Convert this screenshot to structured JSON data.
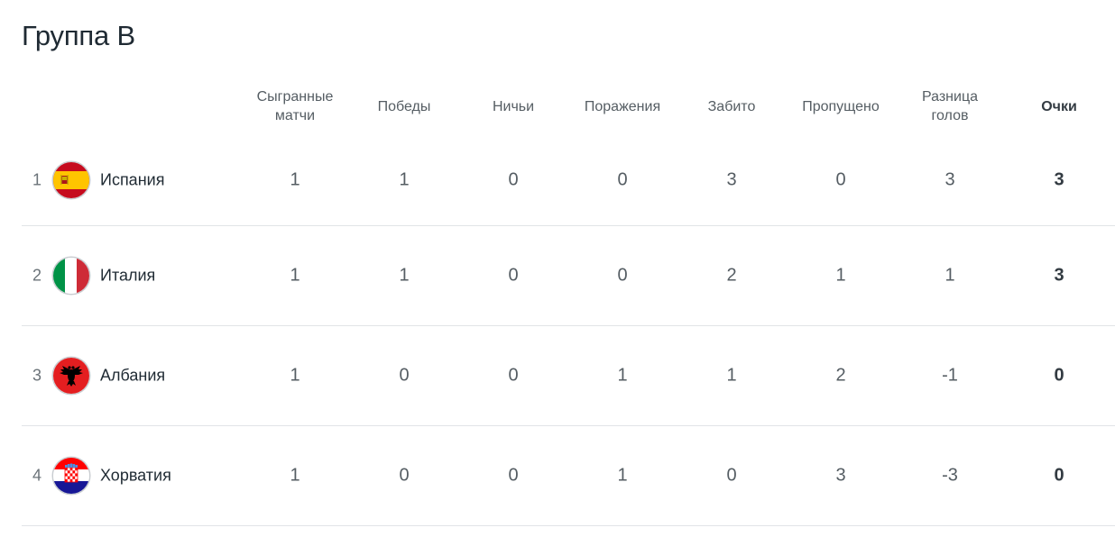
{
  "title": "Группа B",
  "headers": {
    "played": "Сыгранные\nматчи",
    "wins": "Победы",
    "draws": "Ничьи",
    "losses": "Поражения",
    "scored": "Забито",
    "conceded": "Пропущено",
    "diff": "Разница\nголов",
    "points": "Очки"
  },
  "rows": [
    {
      "pos": "1",
      "team": "Испания",
      "flag": "spain-flag-icon",
      "played": "1",
      "wins": "1",
      "draws": "0",
      "losses": "0",
      "scored": "3",
      "conceded": "0",
      "diff": "3",
      "points": "3"
    },
    {
      "pos": "2",
      "team": "Италия",
      "flag": "italy-flag-icon",
      "played": "1",
      "wins": "1",
      "draws": "0",
      "losses": "0",
      "scored": "2",
      "conceded": "1",
      "diff": "1",
      "points": "3"
    },
    {
      "pos": "3",
      "team": "Албания",
      "flag": "albania-flag-icon",
      "played": "1",
      "wins": "0",
      "draws": "0",
      "losses": "1",
      "scored": "1",
      "conceded": "2",
      "diff": "-1",
      "points": "0"
    },
    {
      "pos": "4",
      "team": "Хорватия",
      "flag": "croatia-flag-icon",
      "played": "1",
      "wins": "0",
      "draws": "0",
      "losses": "1",
      "scored": "0",
      "conceded": "3",
      "diff": "-3",
      "points": "0"
    }
  ],
  "colors": {
    "text": "#1f2a33",
    "muted": "#555d63",
    "divider": "#e1e4e7",
    "spain_red": "#c60b1e",
    "spain_yellow": "#ffc400",
    "italy_green": "#009246",
    "italy_red": "#ce2b37",
    "albania_red": "#e41e20",
    "croatia_red": "#ff0000",
    "croatia_blue": "#171796"
  }
}
